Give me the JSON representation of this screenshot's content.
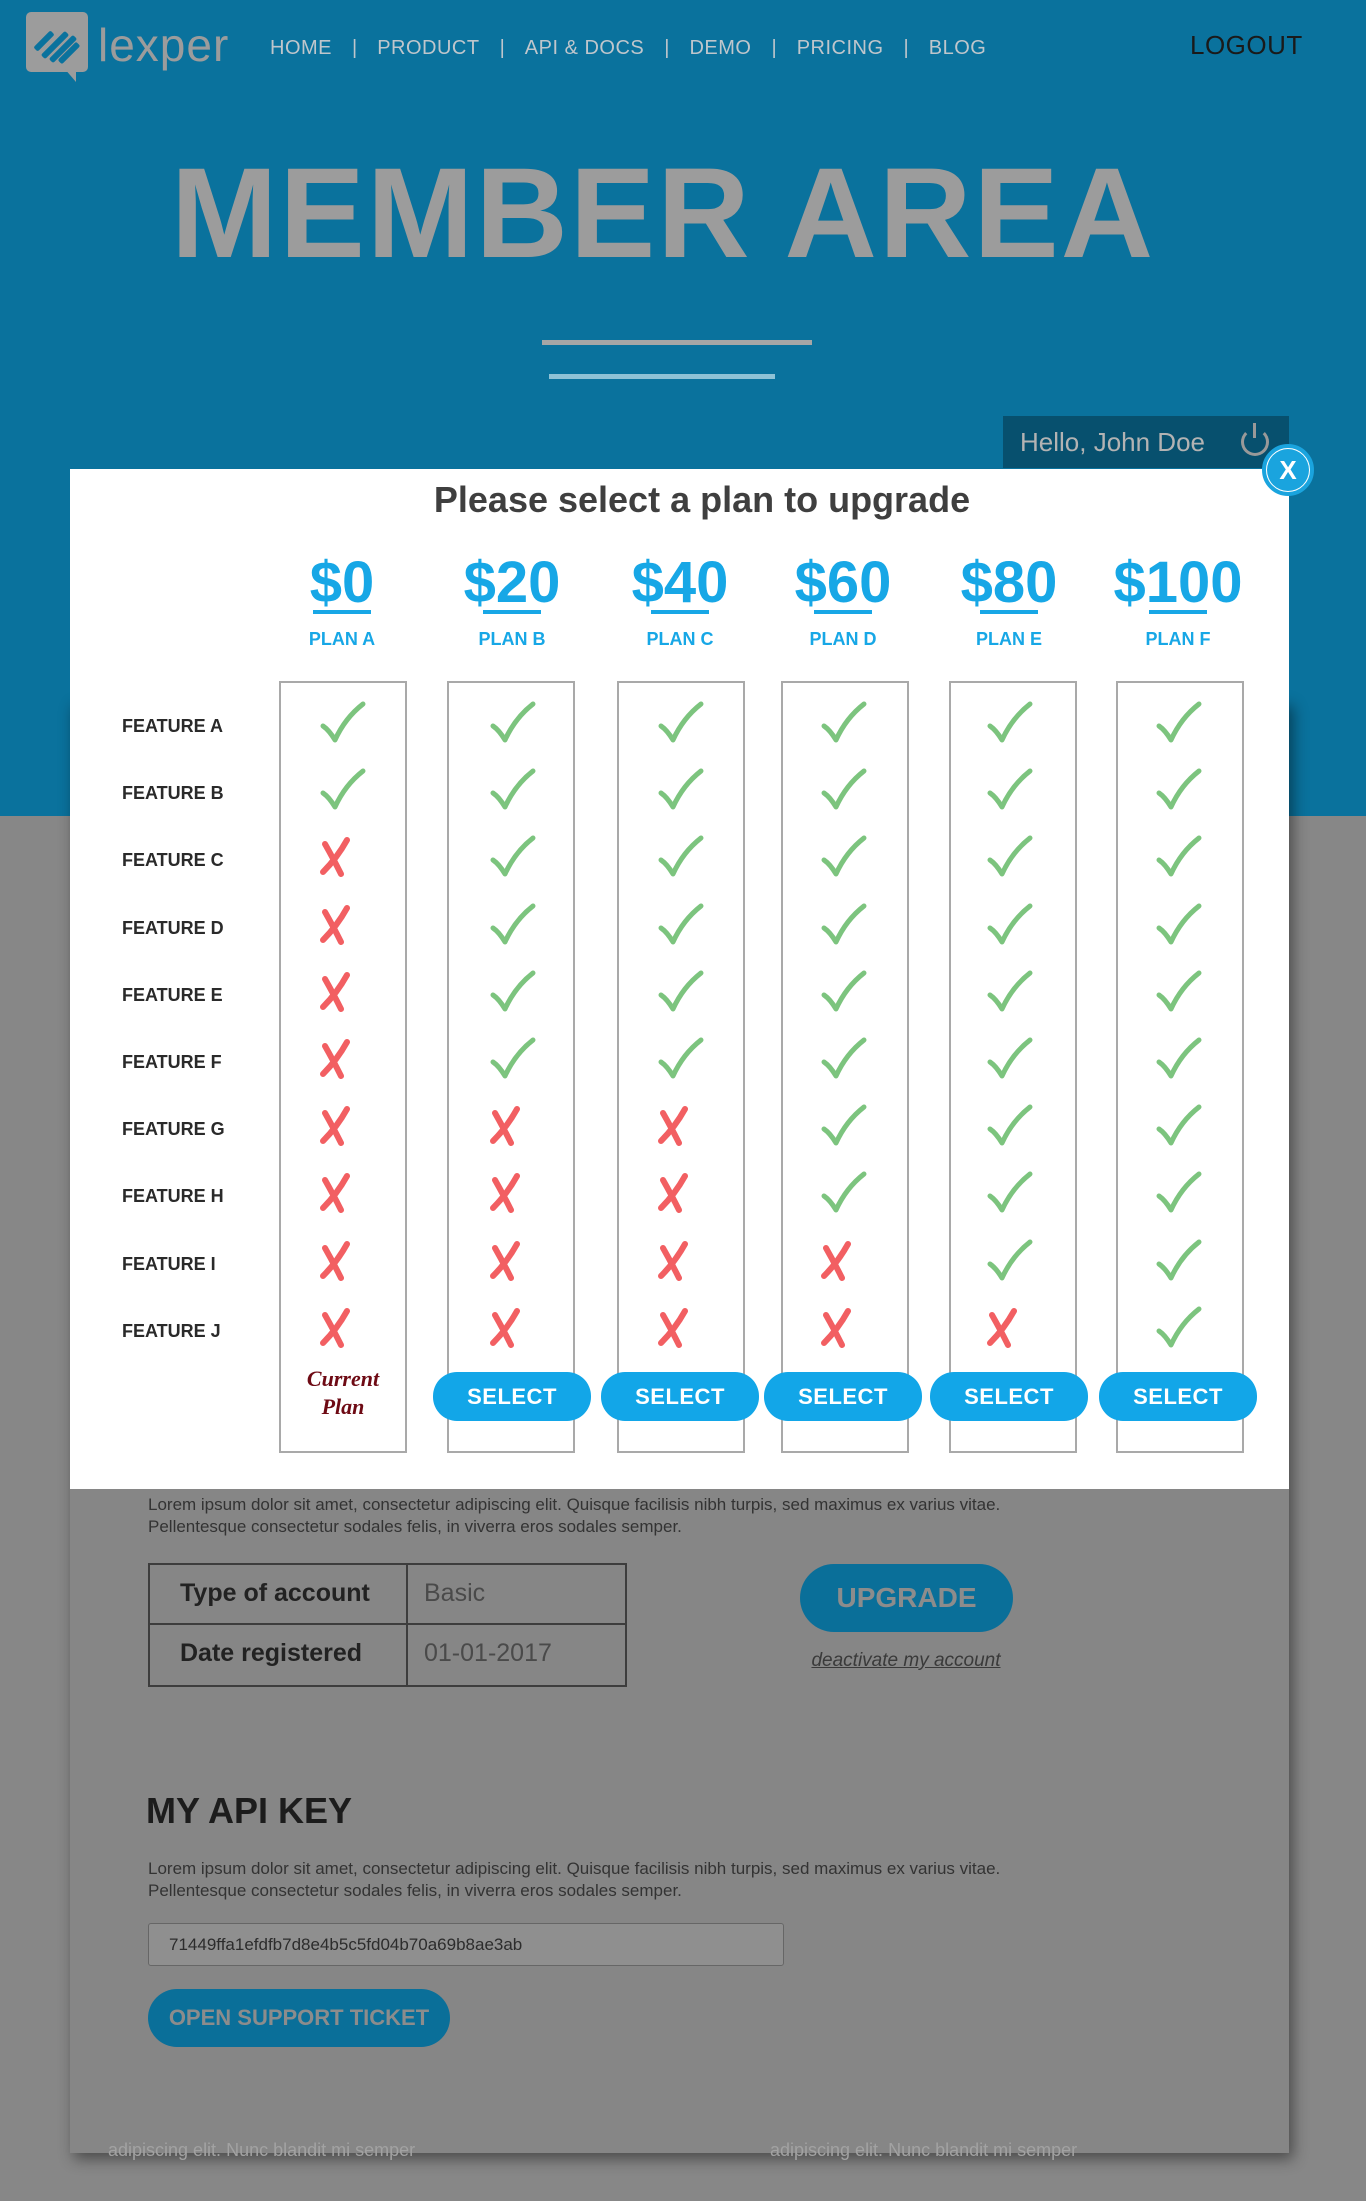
{
  "header": {
    "logo_text": "lexper",
    "nav": [
      "HOME",
      "PRODUCT",
      "API & DOCS",
      "DEMO",
      "PRICING",
      "BLOG"
    ],
    "nav_separator": "|",
    "logout_label": "LOGOUT"
  },
  "hero": {
    "title": "MEMBER AREA",
    "greeting": "Hello, John Doe"
  },
  "modal": {
    "title": "Please select a plan to upgrade",
    "close_label": "X",
    "features": [
      "FEATURE A",
      "FEATURE B",
      "FEATURE C",
      "FEATURE D",
      "FEATURE E",
      "FEATURE F",
      "FEATURE G",
      "FEATURE H",
      "FEATURE I",
      "FEATURE J"
    ],
    "select_label": "SELECT",
    "current_plan_label": "Current Plan",
    "plans": [
      {
        "price": "$0",
        "name": "PLAN A",
        "current": true,
        "included": [
          true,
          true,
          false,
          false,
          false,
          false,
          false,
          false,
          false,
          false
        ]
      },
      {
        "price": "$20",
        "name": "PLAN B",
        "current": false,
        "included": [
          true,
          true,
          true,
          true,
          true,
          true,
          false,
          false,
          false,
          false
        ]
      },
      {
        "price": "$40",
        "name": "PLAN C",
        "current": false,
        "included": [
          true,
          true,
          true,
          true,
          true,
          true,
          false,
          false,
          false,
          false
        ]
      },
      {
        "price": "$60",
        "name": "PLAN D",
        "current": false,
        "included": [
          true,
          true,
          true,
          true,
          true,
          true,
          true,
          true,
          false,
          false
        ]
      },
      {
        "price": "$80",
        "name": "PLAN E",
        "current": false,
        "included": [
          true,
          true,
          true,
          true,
          true,
          true,
          true,
          true,
          true,
          false
        ]
      },
      {
        "price": "$100",
        "name": "PLAN F",
        "current": false,
        "included": [
          true,
          true,
          true,
          true,
          true,
          true,
          true,
          true,
          true,
          true
        ]
      }
    ],
    "colors": {
      "accent": "#17a7e6",
      "check": "#7cc47e",
      "cross": "#f25f62",
      "current_plan": "#6e0a14"
    }
  },
  "account": {
    "description_lines": [
      "Lorem ipsum dolor sit amet, consectetur adipiscing elit. Quisque facilisis nibh turpis, sed maximus ex varius vitae.",
      "Pellentesque consectetur sodales felis, in viverra eros sodales semper."
    ],
    "rows": [
      {
        "label": "Type of account",
        "value": "Basic"
      },
      {
        "label": "Date registered",
        "value": "01-01-2017"
      }
    ],
    "upgrade_label": "UPGRADE",
    "deactivate_label": "deactivate my account"
  },
  "api": {
    "title": "MY API KEY",
    "description_lines": [
      "Lorem ipsum dolor sit amet, consectetur adipiscing elit. Quisque facilisis nibh turpis, sed maximus ex varius vitae.",
      "Pellentesque consectetur sodales felis, in viverra eros sodales semper."
    ],
    "key_value": "71449ffa1efdfb7d8e4b5c5fd04b70a69b8ae3ab",
    "support_label": "OPEN SUPPORT TICKET"
  },
  "footer": {
    "left_text": "adipiscing elit. Nunc blandit mi semper",
    "right_text": "adipiscing elit. Nunc blandit mi semper"
  }
}
